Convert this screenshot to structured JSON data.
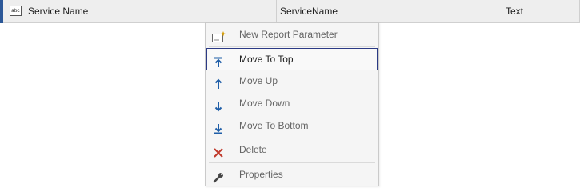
{
  "row": {
    "name_cell": "Service Name",
    "field_cell": "ServiceName",
    "type_cell": "Text",
    "icon": "abc-text-icon",
    "icon_text": "abc"
  },
  "context_menu": {
    "items": [
      {
        "label": "New Report Parameter",
        "icon": "new-parameter-icon"
      },
      {
        "label": "Move To Top",
        "icon": "move-to-top-icon",
        "highlighted": true
      },
      {
        "label": "Move Up",
        "icon": "move-up-icon"
      },
      {
        "label": "Move Down",
        "icon": "move-down-icon"
      },
      {
        "label": "Move To Bottom",
        "icon": "move-to-bottom-icon"
      },
      {
        "label": "Delete",
        "icon": "delete-icon"
      },
      {
        "label": "Properties",
        "icon": "wrench-icon"
      }
    ]
  },
  "colors": {
    "arrow_blue": "#1f5ea8",
    "delete_red": "#c0392b",
    "highlight_border": "#2b3a85",
    "row_accent": "#2b5797"
  }
}
